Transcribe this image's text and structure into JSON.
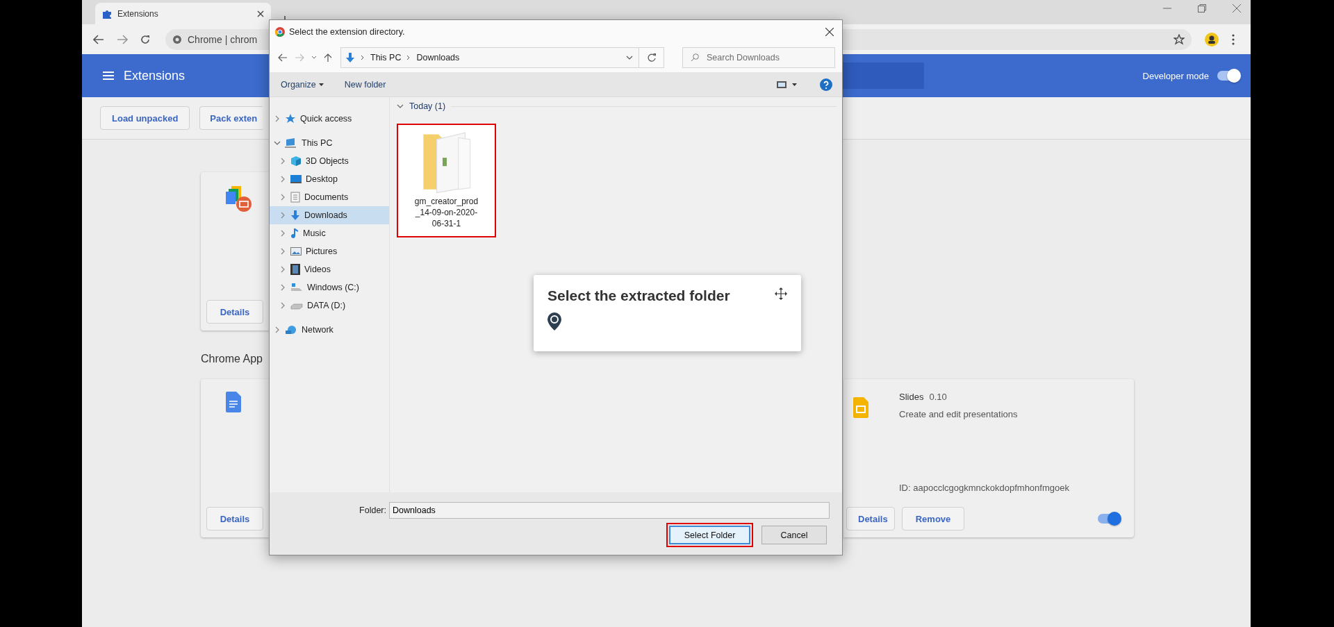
{
  "browser": {
    "tab": {
      "title": "Extensions",
      "selected": true
    },
    "address": "Chrome | chrom"
  },
  "header": {
    "title": "Extensions",
    "developer_mode": {
      "label": "Developer mode",
      "on": true
    }
  },
  "actions": [
    "Load unpacked",
    "Pack exten"
  ],
  "extension_card": {
    "button": "Details"
  },
  "apps_heading": "Chrome App",
  "app_card": {
    "button": "Details"
  },
  "slides_card": {
    "name": "Slides",
    "version": "0.10",
    "description": "Create and edit presentations",
    "id": "ID: aapocclcgogkmnckokdopfmhonfmgoek",
    "buttons": [
      "Details",
      "Remove"
    ],
    "on": true
  },
  "dialog": {
    "title": "Select the extension directory.",
    "path": [
      "This PC",
      "Downloads"
    ],
    "search": {
      "placeholder": "Search Downloads"
    },
    "commands": [
      "Organize",
      "New folder"
    ],
    "tree": [
      {
        "label": "Quick access",
        "kind": "star",
        "expanded": false,
        "selected": false
      },
      {
        "label": "This PC",
        "kind": "pc",
        "expanded": true,
        "selected": false,
        "children": [
          {
            "label": "3D Objects",
            "kind": "cube",
            "expanded": false,
            "selected": false
          },
          {
            "label": "Desktop",
            "kind": "desktop",
            "expanded": false,
            "selected": false
          },
          {
            "label": "Documents",
            "kind": "document",
            "expanded": false,
            "selected": false
          },
          {
            "label": "Downloads",
            "kind": "download",
            "expanded": false,
            "selected": true
          },
          {
            "label": "Music",
            "kind": "music",
            "expanded": false,
            "selected": false
          },
          {
            "label": "Pictures",
            "kind": "picture",
            "expanded": false,
            "selected": false
          },
          {
            "label": "Videos",
            "kind": "video",
            "expanded": false,
            "selected": false
          },
          {
            "label": "Windows (C:)",
            "kind": "system-drive",
            "expanded": false,
            "selected": false
          },
          {
            "label": "DATA (D:)",
            "kind": "drive",
            "expanded": false,
            "selected": false
          }
        ]
      },
      {
        "label": "Network",
        "kind": "network",
        "expanded": false,
        "selected": false
      }
    ],
    "group": {
      "label": "Today (1)",
      "expanded": true
    },
    "items": [
      {
        "name": "gm_creator_prod_14-09-on-2020-06-31-1",
        "highlighted": true
      }
    ],
    "folder": {
      "label": "Folder:",
      "value": "Downloads"
    },
    "buttons": [
      {
        "label": "Select Folder",
        "kind": "default",
        "highlighted": true
      },
      {
        "label": "Cancel",
        "kind": "normal",
        "highlighted": false
      }
    ]
  },
  "callout": {
    "text": "Select the extracted folder"
  }
}
